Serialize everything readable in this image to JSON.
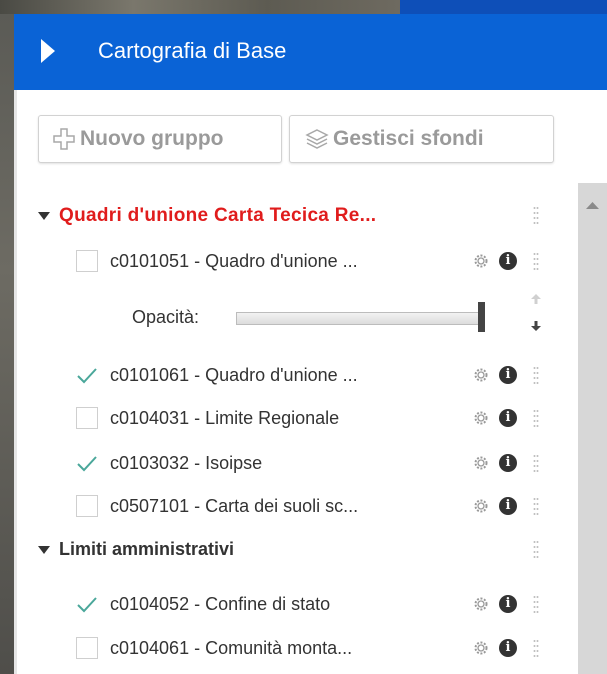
{
  "panel": {
    "title": "Cartografia di Base",
    "buttons": {
      "new_group": "Nuovo gruppo",
      "manage_backgrounds": "Gestisci sfondi"
    }
  },
  "groups": [
    {
      "name": "Quadri d'unione Carta Tecica Re...",
      "color": "#e01c1c",
      "expanded": true,
      "layers": [
        {
          "label": "c0101051 - Quadro d'unione ...",
          "checked": false
        },
        {
          "label": "c0101061 - Quadro d'unione ...",
          "checked": true
        },
        {
          "label": "c0104031 - Limite Regionale",
          "checked": false
        },
        {
          "label": "c0103032 - Isoipse",
          "checked": true
        },
        {
          "label": "c0507101 - Carta dei suoli sc...",
          "checked": false
        }
      ]
    },
    {
      "name": "Limiti amministrativi",
      "color": "#333333",
      "expanded": true,
      "layers": [
        {
          "label": "c0104052 - Confine di stato",
          "checked": true
        },
        {
          "label": "c0104061 - Comunità monta...",
          "checked": false
        }
      ]
    }
  ],
  "opacity": {
    "label": "Opacità:",
    "value": 1.0
  },
  "icons": {
    "header": "play-arrow-icon",
    "new_group": "plus-icon",
    "manage_backgrounds": "layers-icon",
    "settings": "gear-icon",
    "info": "info-icon",
    "drag": "drag-handle-icon",
    "checked": "checkmark-icon"
  },
  "colors": {
    "header_bg": "#0a63d6",
    "accent_check": "#4aa79a",
    "group_highlight": "#e01c1c"
  }
}
